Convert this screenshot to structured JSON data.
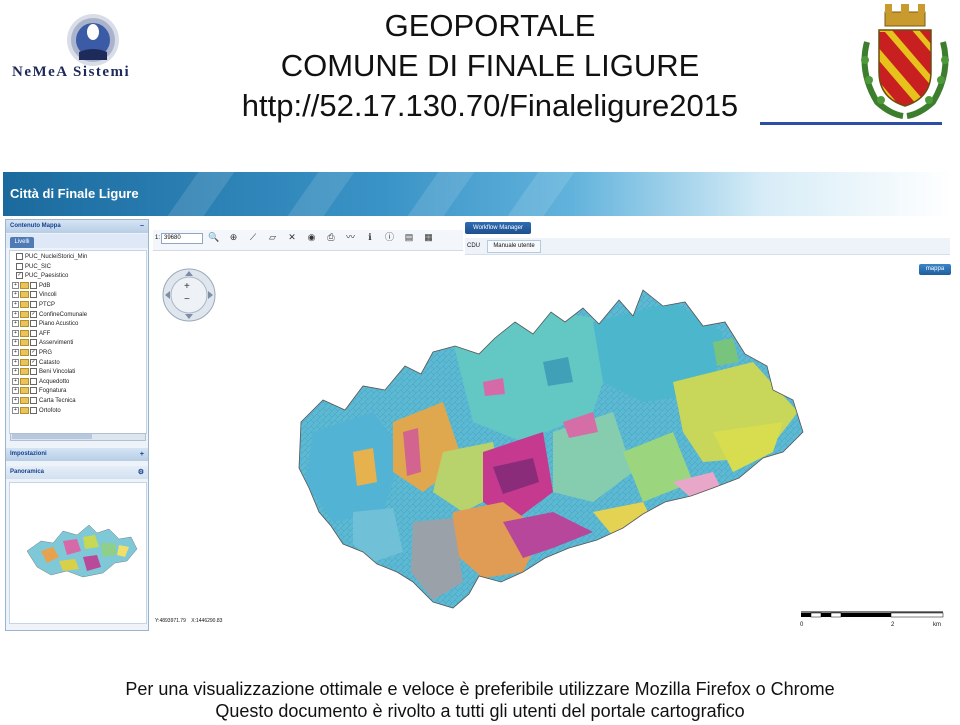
{
  "header": {
    "title_lines": [
      "GEOPORTALE",
      "COMUNE DI FINALE LIGURE",
      "http://52.17.130.70/Finaleligure2015"
    ],
    "logo_text": "NeMeA Sistemi",
    "crest": "comune-crest-icon"
  },
  "app": {
    "title": "Città di Finale Ligure",
    "left_panel": {
      "contenuto_mappa_title": "Contenuto Mappa",
      "tab_livelli": "Livelli",
      "layers": [
        {
          "label": "PUC_NucleiStorici_Min",
          "checked": false
        },
        {
          "label": "PUC_SIC",
          "checked": false
        },
        {
          "label": "PUC_Paesistico",
          "checked": true
        },
        {
          "label": "PdB",
          "checked": false
        },
        {
          "label": "Vincoli",
          "checked": false
        },
        {
          "label": "PTCP",
          "checked": false
        },
        {
          "label": "ConfineComunale",
          "checked": true
        },
        {
          "label": "Piano Acustico",
          "checked": false
        },
        {
          "label": "AFF",
          "checked": false
        },
        {
          "label": "Asservimenti",
          "checked": false
        },
        {
          "label": "PRG",
          "checked": true
        },
        {
          "label": "Catasto",
          "checked": true
        },
        {
          "label": "Beni Vincolati",
          "checked": false
        },
        {
          "label": "Acquedotto",
          "checked": false
        },
        {
          "label": "Fognatura",
          "checked": false
        },
        {
          "label": "Carta Tecnica",
          "checked": false
        },
        {
          "label": "Ortofoto",
          "checked": false
        }
      ],
      "impostazioni_title": "Impostazioni",
      "panoramica_title": "Panoramica"
    },
    "toolbar": {
      "scale_prefix": "1:",
      "scale_value": "39680",
      "tools": [
        "zoom-icon",
        "zoom-in-icon",
        "measure-line-icon",
        "measure-area-icon",
        "clear-icon",
        "identify-icon",
        "print-icon",
        "draw-line-icon",
        "info-icon",
        "info-point-icon",
        "print2-icon",
        "pdf-icon"
      ]
    },
    "workflow_manager": "Workflow Manager",
    "cdu_label": "CDU",
    "manuale_label": "Manuale utente",
    "mappa_label": "mappa",
    "nav": {
      "plus": "+",
      "minus": "−"
    },
    "coords": "Y:4893971.79  X:1446290.83",
    "scalebar": {
      "zero": "0",
      "two": "2",
      "unit": "km"
    }
  },
  "footer": {
    "line1": "Per una visualizzazione ottimale e veloce è preferibile utilizzare Mozilla Firefox o Chrome",
    "line2": "Questo documento è rivolto a tutti gli utenti del portale cartografico"
  },
  "colors": {
    "banner_dark": "#1b6a9e",
    "panel_header": "#15428b",
    "map_base": "#56b8d6",
    "map_cyan": "#4fc3c8",
    "map_magenta": "#c2348f",
    "map_yellow": "#d5dd54",
    "map_green": "#8fcf8a",
    "map_orange": "#e79a52",
    "map_grey": "#9aa1a8"
  }
}
